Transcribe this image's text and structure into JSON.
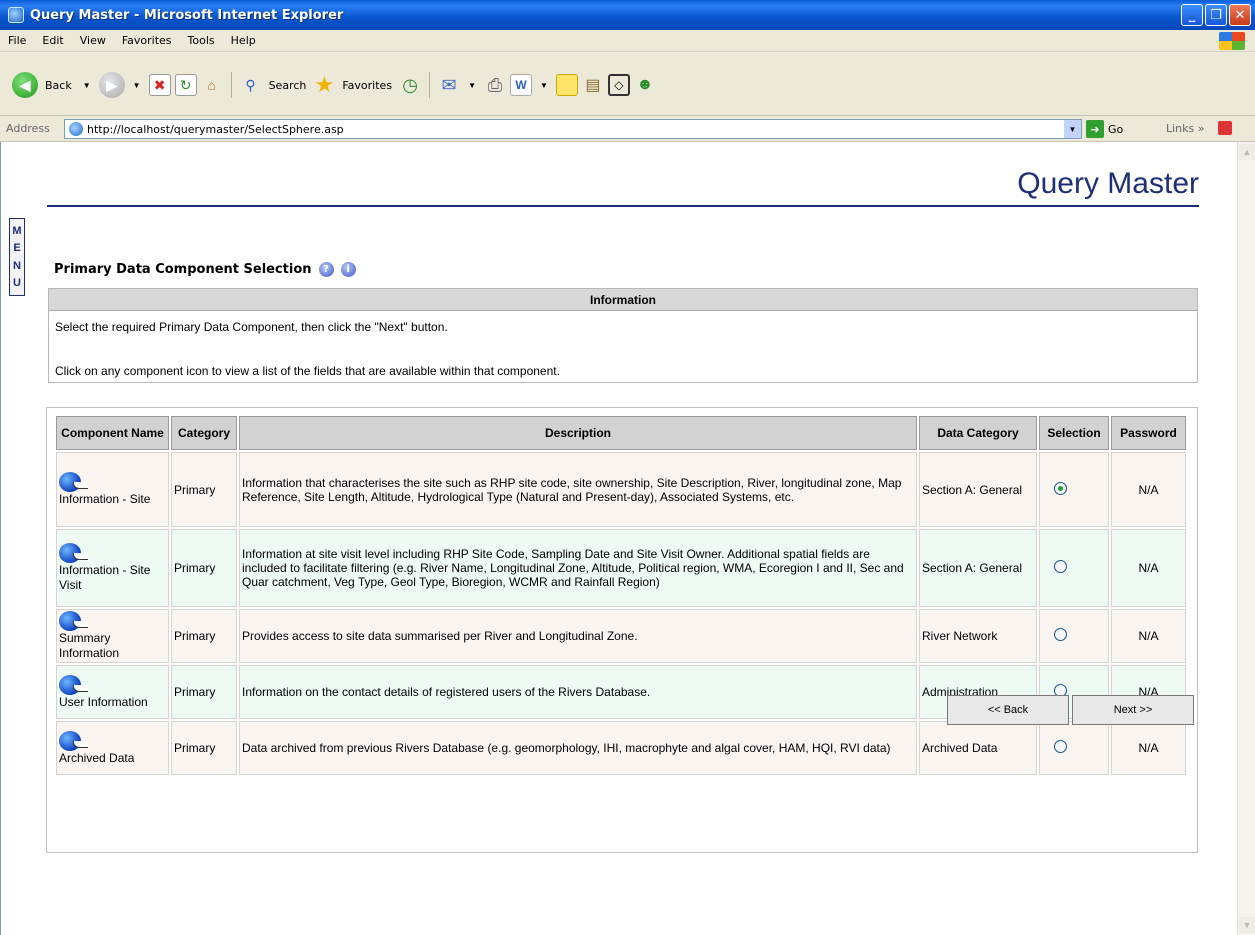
{
  "window": {
    "title": "Query Master - Microsoft Internet Explorer"
  },
  "menubar": [
    "File",
    "Edit",
    "View",
    "Favorites",
    "Tools",
    "Help"
  ],
  "toolbar": {
    "back_label": "Back",
    "search_label": "Search",
    "favorites_label": "Favorites"
  },
  "address": {
    "label": "Address",
    "url": "http://localhost/querymaster/SelectSphere.asp",
    "go_label": "Go",
    "links_label": "Links"
  },
  "page": {
    "title": "Query Master",
    "menu_letters": [
      "M",
      "E",
      "N",
      "U"
    ],
    "section_heading": "Primary Data Component Selection",
    "info": {
      "header": "Information",
      "line1": "Select the required Primary Data Component, then click the \"Next\" button.",
      "line2": "Click on any component icon to view a list of the fields that are available within that component."
    },
    "table": {
      "headers": {
        "name": "Component Name",
        "category": "Category",
        "description": "Description",
        "data_category": "Data Category",
        "selection": "Selection",
        "password": "Password"
      },
      "rows": [
        {
          "name": "Information - Site",
          "category": "Primary",
          "description": "Information that characterises the site such as RHP site code, site ownership, Site Description, River, longitudinal zone, Map Reference, Site Length, Altitude, Hydrological Type (Natural and Present-day), Associated Systems, etc.",
          "data_category": "Section A: General",
          "selected": true,
          "password": "N/A"
        },
        {
          "name": "Information - Site Visit",
          "category": "Primary",
          "description": "Information at site visit level including RHP Site Code, Sampling Date and Site Visit Owner. Additional spatial fields are included to facilitate filtering (e.g. River Name, Longitudinal Zone, Altitude, Political region, WMA, Ecoregion I and II, Sec and Quar catchment, Veg Type, Geol Type, Bioregion, WCMR and Rainfall Region)",
          "data_category": "Section A: General",
          "selected": false,
          "password": "N/A"
        },
        {
          "name": "Summary Information",
          "category": "Primary",
          "description": "Provides access to site data summarised per River and Longitudinal Zone.",
          "data_category": "River Network",
          "selected": false,
          "password": "N/A"
        },
        {
          "name": "User Information",
          "category": "Primary",
          "description": "Information on the contact details of registered users of the Rivers Database.",
          "data_category": "Administration",
          "selected": false,
          "password": "N/A"
        },
        {
          "name": "Archived Data",
          "category": "Primary",
          "description": "Data archived from previous Rivers Database (e.g. geomorphology, IHI, macrophyte and algal cover, HAM, HQI, RVI data)",
          "data_category": "Archived Data",
          "selected": false,
          "password": "N/A"
        }
      ]
    },
    "buttons": {
      "back": "<< Back",
      "next": "Next >>"
    }
  }
}
